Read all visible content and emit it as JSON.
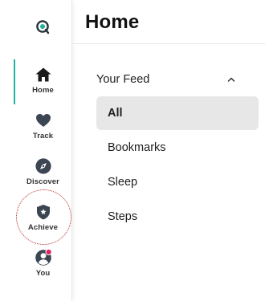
{
  "header": {
    "title": "Home"
  },
  "nav": {
    "items": [
      {
        "label": "Home",
        "icon": "home-icon",
        "active": true
      },
      {
        "label": "Track",
        "icon": "heart-icon"
      },
      {
        "label": "Discover",
        "icon": "compass-icon"
      },
      {
        "label": "Achieve",
        "icon": "shield-star-icon"
      },
      {
        "label": "You",
        "icon": "profile-icon",
        "notification": true
      }
    ]
  },
  "feed": {
    "title": "Your Feed",
    "items": [
      {
        "label": "All",
        "selected": true
      },
      {
        "label": "Bookmarks"
      },
      {
        "label": "Sleep"
      },
      {
        "label": "Steps"
      }
    ]
  },
  "colors": {
    "accent": "#20b2a0",
    "icon": "#3c4552",
    "notification": "#e0245e",
    "annotation": "#b52a2a",
    "selected_bg": "#e7e7e7"
  }
}
